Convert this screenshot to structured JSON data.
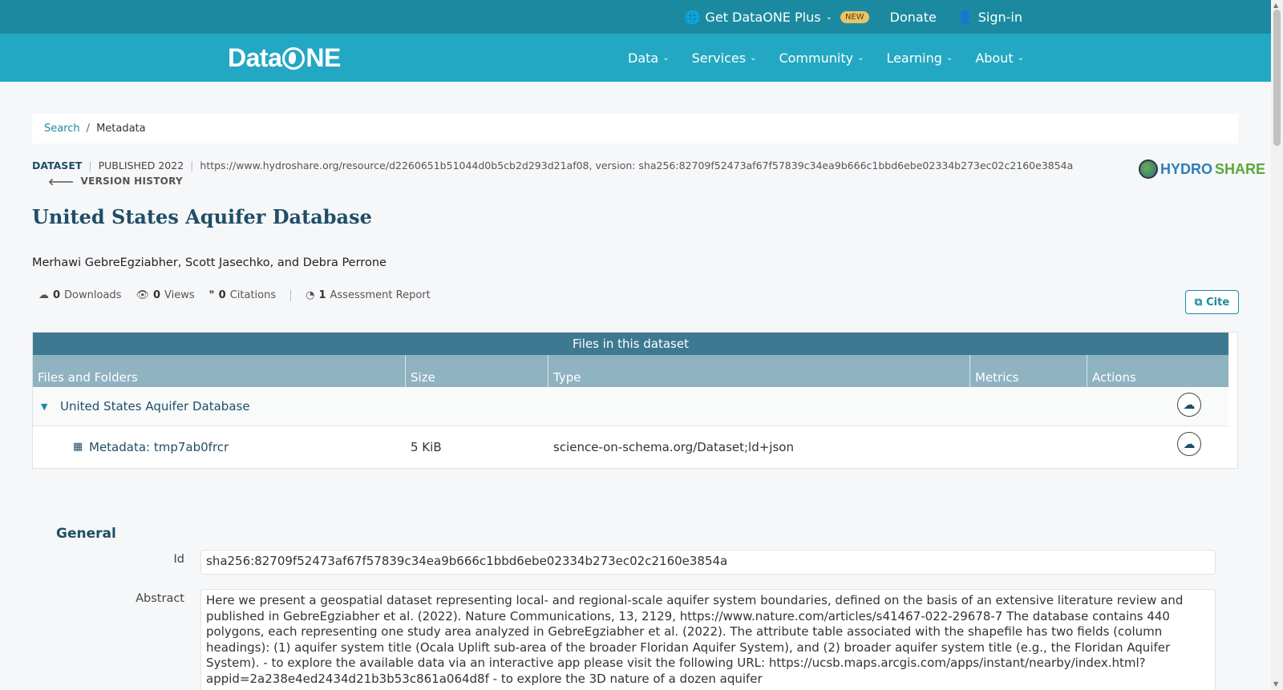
{
  "topbar": {
    "plus_label": "Get DataONE Plus",
    "new_badge": "NEW",
    "donate_label": "Donate",
    "signin_label": "Sign-in"
  },
  "nav": {
    "logo": {
      "text_a": "Data",
      "text_b": "NE"
    },
    "items": [
      {
        "label": "Data"
      },
      {
        "label": "Services"
      },
      {
        "label": "Community"
      },
      {
        "label": "Learning"
      },
      {
        "label": "About"
      }
    ]
  },
  "breadcrumb": {
    "search": "Search",
    "separator": "/",
    "current": "Metadata"
  },
  "meta": {
    "type": "DATASET",
    "published": "PUBLISHED 2022",
    "identifier": "https://www.hydroshare.org/resource/d2260651b51044d0b5cb2d293d21af08, version: sha256:82709f52473af67f57839c34ea9b666c1bbd6ebe02334b273ec02c2160e3854a",
    "version_history": "VERSION HISTORY",
    "repository": {
      "a": "HYDRO",
      "b": "SHARE"
    }
  },
  "dataset": {
    "title": "United States Aquifer Database",
    "authors": "Merhawi GebreEgziabher, Scott Jasechko, and Debra Perrone"
  },
  "metrics": {
    "downloads_count": "0",
    "downloads_label": "Downloads",
    "views_count": "0",
    "views_label": "Views",
    "citations_count": "0",
    "citations_label": "Citations",
    "assessment_count": "1",
    "assessment_label": "Assessment Report",
    "cite_label": "Cite"
  },
  "files": {
    "header": "Files in this dataset",
    "columns": [
      "Files and Folders",
      "Size",
      "Type",
      "Metrics",
      "Actions"
    ],
    "folder": {
      "name": "United States Aquifer Database"
    },
    "rows": [
      {
        "name": "Metadata: tmp7ab0frcr",
        "size": "5 KiB",
        "type": "science-on-schema.org/Dataset;ld+json"
      }
    ]
  },
  "general": {
    "title": "General",
    "id_label": "Id",
    "id_value": "sha256:82709f52473af67f57839c34ea9b666c1bbd6ebe02334b273ec02c2160e3854a",
    "abstract_label": "Abstract",
    "abstract_value": "Here we present a geospatial dataset representing local- and regional-scale aquifer system boundaries, defined on the basis of an extensive literature review and published in GebreEgziabher et al. (2022). Nature Communications, 13, 2129, https://www.nature.com/articles/s41467-022-29678-7 The database contains 440 polygons, each representing one study area analyzed in GebreEgziabher et al. (2022). The attribute table associated with the shapefile has two fields (column headings): (1) aquifer system title (Ocala Uplift sub-area of the broader Floridan Aquifer System), and (2) broader aquifer system title (e.g., the Floridan Aquifer System). - to explore the available data via an interactive app please visit the following URL: https://ucsb.maps.arcgis.com/apps/instant/nearby/index.html?appid=2a238e4ed2434d21b3b53c861a064d8f - to explore the 3D nature of a dozen aquifer"
  }
}
